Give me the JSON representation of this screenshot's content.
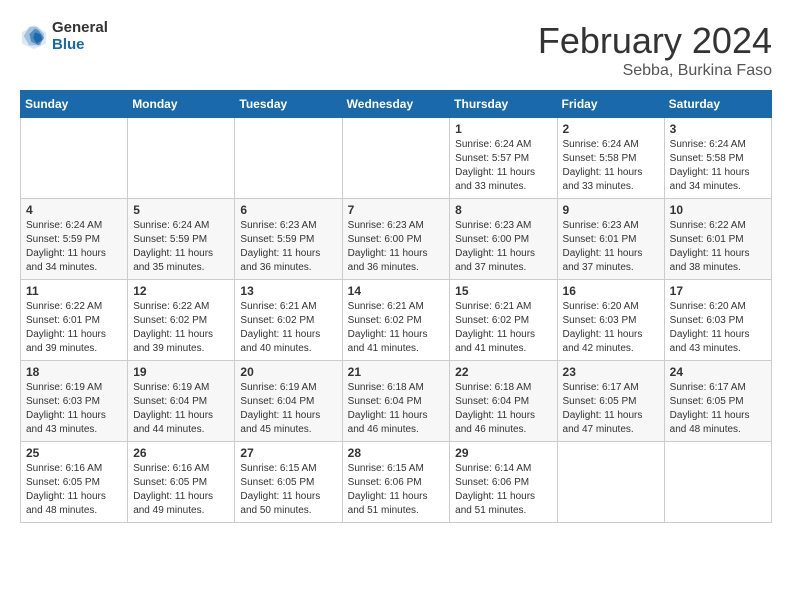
{
  "header": {
    "logo_line1": "General",
    "logo_line2": "Blue",
    "month_title": "February 2024",
    "location": "Sebba, Burkina Faso"
  },
  "weekdays": [
    "Sunday",
    "Monday",
    "Tuesday",
    "Wednesday",
    "Thursday",
    "Friday",
    "Saturday"
  ],
  "weeks": [
    [
      {
        "day": "",
        "info": ""
      },
      {
        "day": "",
        "info": ""
      },
      {
        "day": "",
        "info": ""
      },
      {
        "day": "",
        "info": ""
      },
      {
        "day": "1",
        "info": "Sunrise: 6:24 AM\nSunset: 5:57 PM\nDaylight: 11 hours\nand 33 minutes."
      },
      {
        "day": "2",
        "info": "Sunrise: 6:24 AM\nSunset: 5:58 PM\nDaylight: 11 hours\nand 33 minutes."
      },
      {
        "day": "3",
        "info": "Sunrise: 6:24 AM\nSunset: 5:58 PM\nDaylight: 11 hours\nand 34 minutes."
      }
    ],
    [
      {
        "day": "4",
        "info": "Sunrise: 6:24 AM\nSunset: 5:59 PM\nDaylight: 11 hours\nand 34 minutes."
      },
      {
        "day": "5",
        "info": "Sunrise: 6:24 AM\nSunset: 5:59 PM\nDaylight: 11 hours\nand 35 minutes."
      },
      {
        "day": "6",
        "info": "Sunrise: 6:23 AM\nSunset: 5:59 PM\nDaylight: 11 hours\nand 36 minutes."
      },
      {
        "day": "7",
        "info": "Sunrise: 6:23 AM\nSunset: 6:00 PM\nDaylight: 11 hours\nand 36 minutes."
      },
      {
        "day": "8",
        "info": "Sunrise: 6:23 AM\nSunset: 6:00 PM\nDaylight: 11 hours\nand 37 minutes."
      },
      {
        "day": "9",
        "info": "Sunrise: 6:23 AM\nSunset: 6:01 PM\nDaylight: 11 hours\nand 37 minutes."
      },
      {
        "day": "10",
        "info": "Sunrise: 6:22 AM\nSunset: 6:01 PM\nDaylight: 11 hours\nand 38 minutes."
      }
    ],
    [
      {
        "day": "11",
        "info": "Sunrise: 6:22 AM\nSunset: 6:01 PM\nDaylight: 11 hours\nand 39 minutes."
      },
      {
        "day": "12",
        "info": "Sunrise: 6:22 AM\nSunset: 6:02 PM\nDaylight: 11 hours\nand 39 minutes."
      },
      {
        "day": "13",
        "info": "Sunrise: 6:21 AM\nSunset: 6:02 PM\nDaylight: 11 hours\nand 40 minutes."
      },
      {
        "day": "14",
        "info": "Sunrise: 6:21 AM\nSunset: 6:02 PM\nDaylight: 11 hours\nand 41 minutes."
      },
      {
        "day": "15",
        "info": "Sunrise: 6:21 AM\nSunset: 6:02 PM\nDaylight: 11 hours\nand 41 minutes."
      },
      {
        "day": "16",
        "info": "Sunrise: 6:20 AM\nSunset: 6:03 PM\nDaylight: 11 hours\nand 42 minutes."
      },
      {
        "day": "17",
        "info": "Sunrise: 6:20 AM\nSunset: 6:03 PM\nDaylight: 11 hours\nand 43 minutes."
      }
    ],
    [
      {
        "day": "18",
        "info": "Sunrise: 6:19 AM\nSunset: 6:03 PM\nDaylight: 11 hours\nand 43 minutes."
      },
      {
        "day": "19",
        "info": "Sunrise: 6:19 AM\nSunset: 6:04 PM\nDaylight: 11 hours\nand 44 minutes."
      },
      {
        "day": "20",
        "info": "Sunrise: 6:19 AM\nSunset: 6:04 PM\nDaylight: 11 hours\nand 45 minutes."
      },
      {
        "day": "21",
        "info": "Sunrise: 6:18 AM\nSunset: 6:04 PM\nDaylight: 11 hours\nand 46 minutes."
      },
      {
        "day": "22",
        "info": "Sunrise: 6:18 AM\nSunset: 6:04 PM\nDaylight: 11 hours\nand 46 minutes."
      },
      {
        "day": "23",
        "info": "Sunrise: 6:17 AM\nSunset: 6:05 PM\nDaylight: 11 hours\nand 47 minutes."
      },
      {
        "day": "24",
        "info": "Sunrise: 6:17 AM\nSunset: 6:05 PM\nDaylight: 11 hours\nand 48 minutes."
      }
    ],
    [
      {
        "day": "25",
        "info": "Sunrise: 6:16 AM\nSunset: 6:05 PM\nDaylight: 11 hours\nand 48 minutes."
      },
      {
        "day": "26",
        "info": "Sunrise: 6:16 AM\nSunset: 6:05 PM\nDaylight: 11 hours\nand 49 minutes."
      },
      {
        "day": "27",
        "info": "Sunrise: 6:15 AM\nSunset: 6:05 PM\nDaylight: 11 hours\nand 50 minutes."
      },
      {
        "day": "28",
        "info": "Sunrise: 6:15 AM\nSunset: 6:06 PM\nDaylight: 11 hours\nand 51 minutes."
      },
      {
        "day": "29",
        "info": "Sunrise: 6:14 AM\nSunset: 6:06 PM\nDaylight: 11 hours\nand 51 minutes."
      },
      {
        "day": "",
        "info": ""
      },
      {
        "day": "",
        "info": ""
      }
    ]
  ]
}
